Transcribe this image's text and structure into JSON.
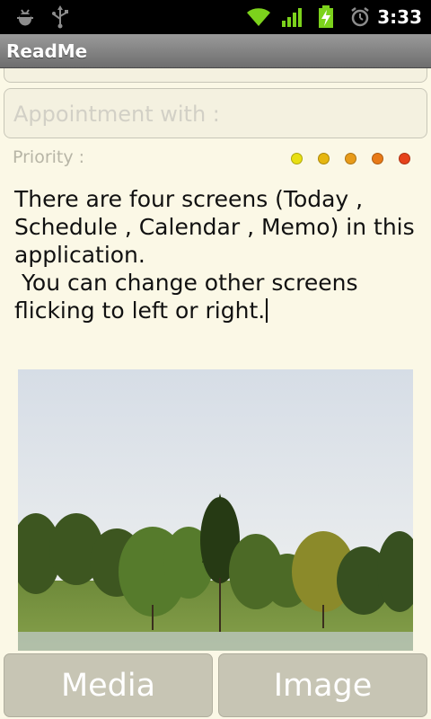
{
  "status_bar": {
    "time": "3:33",
    "icons": [
      "debug-icon",
      "usb-icon",
      "wifi-icon",
      "signal-icon",
      "battery-charging-icon",
      "alarm-icon"
    ]
  },
  "app": {
    "title": "ReadMe"
  },
  "form": {
    "appointment_placeholder": "Appointment with :",
    "priority_label": "Priority :",
    "priority_levels": [
      {
        "color": "#e8df12"
      },
      {
        "color": "#e6b60f"
      },
      {
        "color": "#e89b1a"
      },
      {
        "color": "#e87a17"
      },
      {
        "color": "#e6421b"
      }
    ],
    "memo_text": "There are four screens (Today ,\nSchedule , Calendar , Memo) in this\napplication.\n You can change other screens\nflicking to left or right."
  },
  "buttons": {
    "media_label": "Media",
    "image_label": "Image"
  },
  "colors": {
    "background": "#fbf8e6",
    "button": "#c7c5b4",
    "title_bar": "#8a8a8a"
  }
}
